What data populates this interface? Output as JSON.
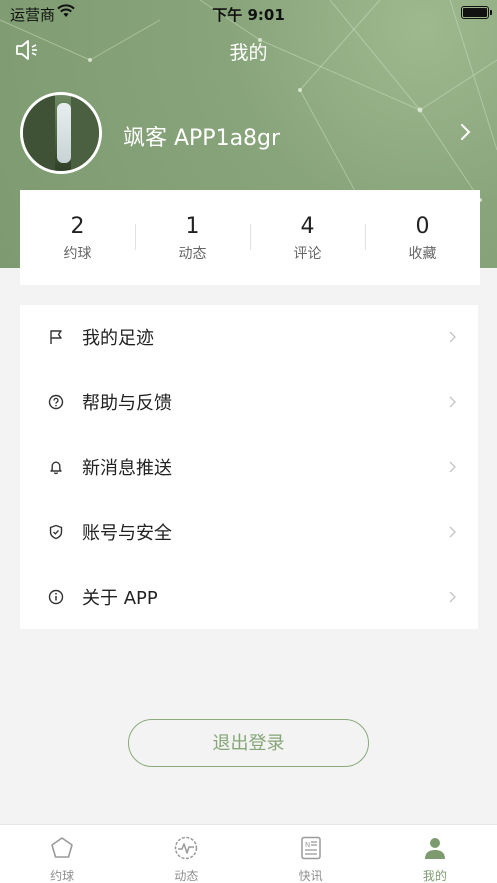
{
  "status_bar": {
    "carrier": "运营商",
    "time": "下午 9:01"
  },
  "navbar": {
    "title": "我的"
  },
  "profile": {
    "name": "飒客 APP1a8gr"
  },
  "stats": [
    {
      "value": "2",
      "label": "约球"
    },
    {
      "value": "1",
      "label": "动态"
    },
    {
      "value": "4",
      "label": "评论"
    },
    {
      "value": "0",
      "label": "收藏"
    }
  ],
  "menu": [
    {
      "label": "我的足迹",
      "icon": "flag-icon"
    },
    {
      "label": "帮助与反馈",
      "icon": "help-icon"
    },
    {
      "label": "新消息推送",
      "icon": "bell-icon"
    },
    {
      "label": "账号与安全",
      "icon": "shield-icon"
    },
    {
      "label": "关于 APP",
      "icon": "info-icon"
    }
  ],
  "logout_label": "退出登录",
  "tabs": [
    {
      "label": "约球",
      "icon": "pentagon-icon"
    },
    {
      "label": "动态",
      "icon": "pulse-icon"
    },
    {
      "label": "快讯",
      "icon": "news-icon"
    },
    {
      "label": "我的",
      "icon": "user-icon",
      "active": true
    }
  ],
  "colors": {
    "accent": "#7e9b6f",
    "header": "#86a47a",
    "background": "#f3f3f3"
  }
}
